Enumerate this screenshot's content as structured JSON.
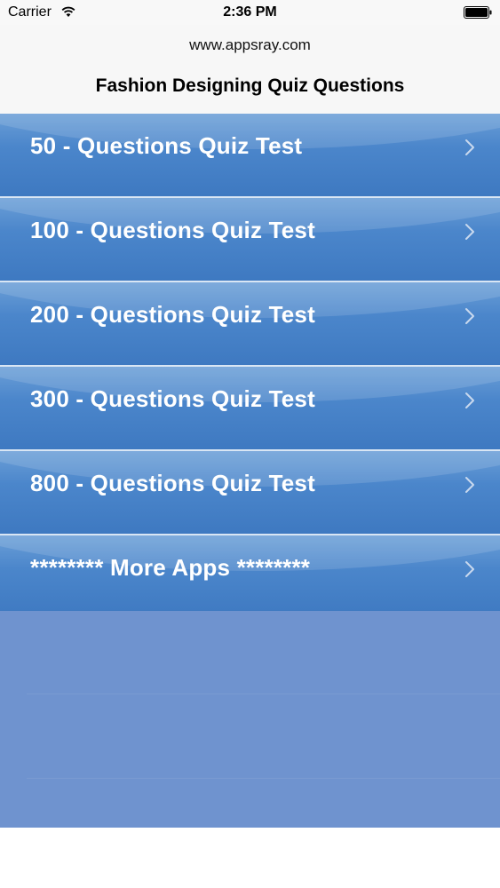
{
  "status_bar": {
    "carrier": "Carrier",
    "time": "2:36 PM",
    "icons": [
      "wifi-icon",
      "battery-icon"
    ]
  },
  "header": {
    "subtitle": "www.appsray.com",
    "title": "Fashion Designing Quiz Questions"
  },
  "list": {
    "items": [
      {
        "label": "50 - Questions Quiz Test"
      },
      {
        "label": "100 - Questions Quiz Test"
      },
      {
        "label": "200 - Questions Quiz Test"
      },
      {
        "label": "300 - Questions Quiz Test"
      },
      {
        "label": "800 - Questions Quiz Test"
      },
      {
        "label": "******** More Apps ********"
      }
    ],
    "accessory_icon": "chevron-right-icon"
  },
  "colors": {
    "row_gradient_top": "#6b9fd7",
    "row_gradient_bottom": "#3e79c1",
    "list_background": "#6f93cf",
    "separator": "#d9e6f4",
    "row_text": "#ffffff"
  }
}
